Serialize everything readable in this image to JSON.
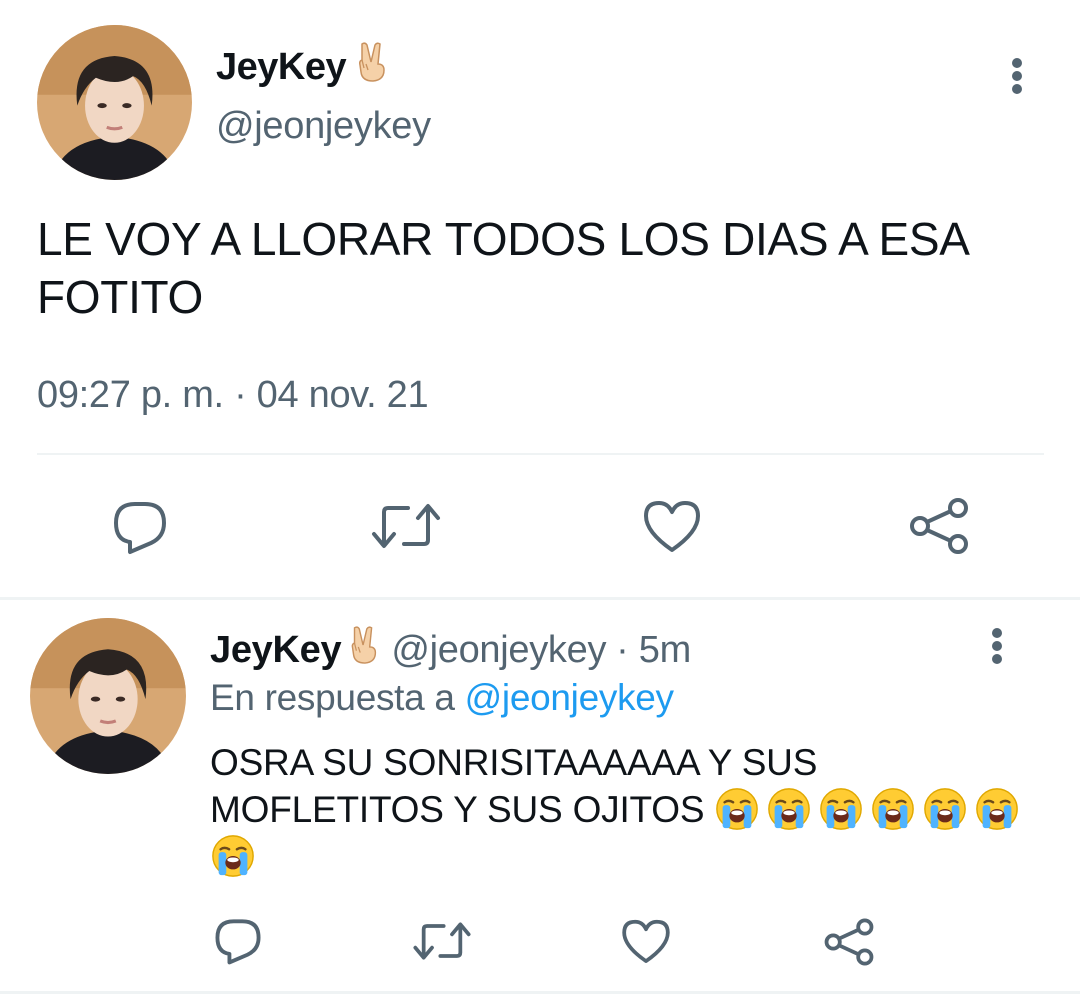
{
  "tweet": {
    "display_name": "JeyKey",
    "name_emoji": "victory-hand",
    "handle": "@jeonjeykey",
    "text": "LE VOY A LLORAR TODOS LOS DIAS A ESA FOTITO",
    "timestamp": "09:27 p. m. · 04 nov. 21",
    "avatar": "profile-photo"
  },
  "actions": {
    "reply": "reply-icon",
    "retweet": "retweet-icon",
    "like": "heart-icon",
    "share": "share-icon"
  },
  "reply": {
    "display_name": "JeyKey",
    "name_emoji": "victory-hand",
    "handle": "@jeonjeykey",
    "age": "· 5m",
    "replying_prefix": "En respuesta a",
    "replying_to": "@jeonjeykey",
    "text": "OSRA SU SONRISITAAAAAA Y SUS MOFLETITOS Y SUS OJITOS",
    "emojis": [
      "loudly-crying-face",
      "loudly-crying-face",
      "loudly-crying-face",
      "loudly-crying-face",
      "loudly-crying-face",
      "loudly-crying-face",
      "loudly-crying-face"
    ],
    "avatar": "profile-photo"
  },
  "colors": {
    "text": "#0f1419",
    "secondary": "#536471",
    "link": "#1d9bf0",
    "divider": "#eff3f4"
  }
}
